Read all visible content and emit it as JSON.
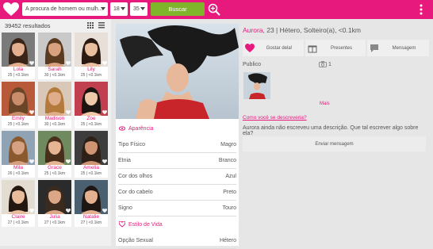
{
  "topbar": {
    "gender_select": "A procura de homem ou mulh...",
    "age_min": "18",
    "age_max": "35",
    "search_label": "Buscar"
  },
  "results": {
    "count": "39452 resultados",
    "cards": [
      {
        "name": "Lola",
        "meta": "25 | <0.1km"
      },
      {
        "name": "Sarah",
        "meta": "30 | <0.1km"
      },
      {
        "name": "Lily",
        "meta": "25 | <0.1km"
      },
      {
        "name": "Emily",
        "meta": "25 | <0.1km"
      },
      {
        "name": "Madison",
        "meta": "30 | <0.1km"
      },
      {
        "name": "Zoe",
        "meta": "25 | <0.1km"
      },
      {
        "name": "Mila",
        "meta": "26 | <0.1km"
      },
      {
        "name": "Grace",
        "meta": "25 | <0.1km"
      },
      {
        "name": "Amelia",
        "meta": "25 | <0.1km"
      },
      {
        "name": "Claire",
        "meta": "27 | <0.1km"
      },
      {
        "name": "Julia",
        "meta": "27 | <0.1km"
      },
      {
        "name": "Natalie",
        "meta": "27 | <0.1km"
      }
    ]
  },
  "profile": {
    "name": "Aurora",
    "info": ", 23 | Hétero, Solteiro(a), <0.1km",
    "like_label": "Gostar dela!",
    "gifts_label": "Presentes",
    "message_label": "Mensagem",
    "public_label": "Publico",
    "photo_count": "1",
    "more_label": "Mais",
    "describe_link": "Como você se descreveria?",
    "description": "Aurora ainda não escreveu uma descrição. Que tal escrever algo sobre ela?",
    "send_label": "Enviar mensagem"
  },
  "appearance": {
    "title": "Aparência",
    "rows": [
      {
        "label": "Tipo Físico",
        "value": "Magro"
      },
      {
        "label": "Etnia",
        "value": "Branco"
      },
      {
        "label": "Cor dos olhos",
        "value": "Azul"
      },
      {
        "label": "Cor do cabelo",
        "value": "Preto"
      },
      {
        "label": "Signo",
        "value": "Touro"
      }
    ]
  },
  "lifestyle": {
    "title": "Estilo de Vida",
    "rows": [
      {
        "label": "Opção Sexual",
        "value": "Hétero"
      }
    ]
  },
  "colors": {
    "brand": "#e8197d",
    "accent": "#7fb52a"
  },
  "icons": [
    "heart-logo-icon",
    "caret-down-icon",
    "search-plus-icon",
    "menu-dots-icon",
    "grid-view-icon",
    "list-view-icon",
    "heart-icon",
    "gift-icon",
    "message-icon",
    "camera-icon",
    "eye-icon",
    "heart-small-icon"
  ]
}
